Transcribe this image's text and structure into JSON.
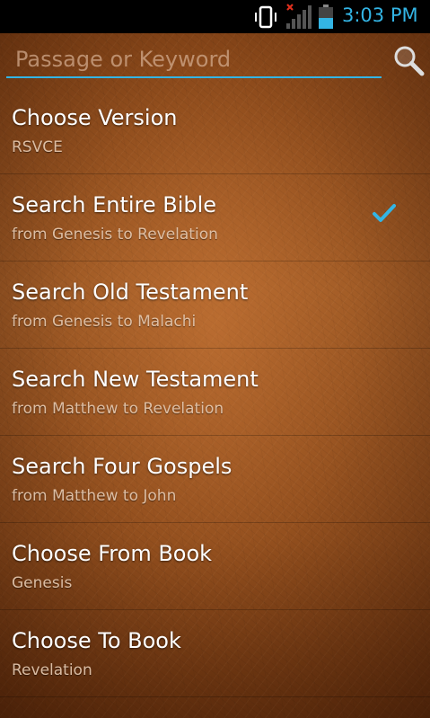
{
  "status_bar": {
    "time": "3:03 PM",
    "icons": [
      "vibrate-icon",
      "no-signal-icon",
      "battery-icon"
    ],
    "accent_color": "#33b5e5"
  },
  "search": {
    "placeholder": "Passage or Keyword",
    "value": "",
    "button_icon": "search-icon"
  },
  "options": [
    {
      "title": "Choose Version",
      "subtitle": "RSVCE",
      "checked": false
    },
    {
      "title": "Search Entire Bible",
      "subtitle": "from Genesis to Revelation",
      "checked": true
    },
    {
      "title": "Search Old Testament",
      "subtitle": "from Genesis to Malachi",
      "checked": false
    },
    {
      "title": "Search New Testament",
      "subtitle": "from Matthew to Revelation",
      "checked": false
    },
    {
      "title": "Search Four Gospels",
      "subtitle": "from Matthew to John",
      "checked": false
    },
    {
      "title": "Choose From Book",
      "subtitle": "Genesis",
      "checked": false
    },
    {
      "title": "Choose To Book",
      "subtitle": "Revelation",
      "checked": false
    }
  ]
}
